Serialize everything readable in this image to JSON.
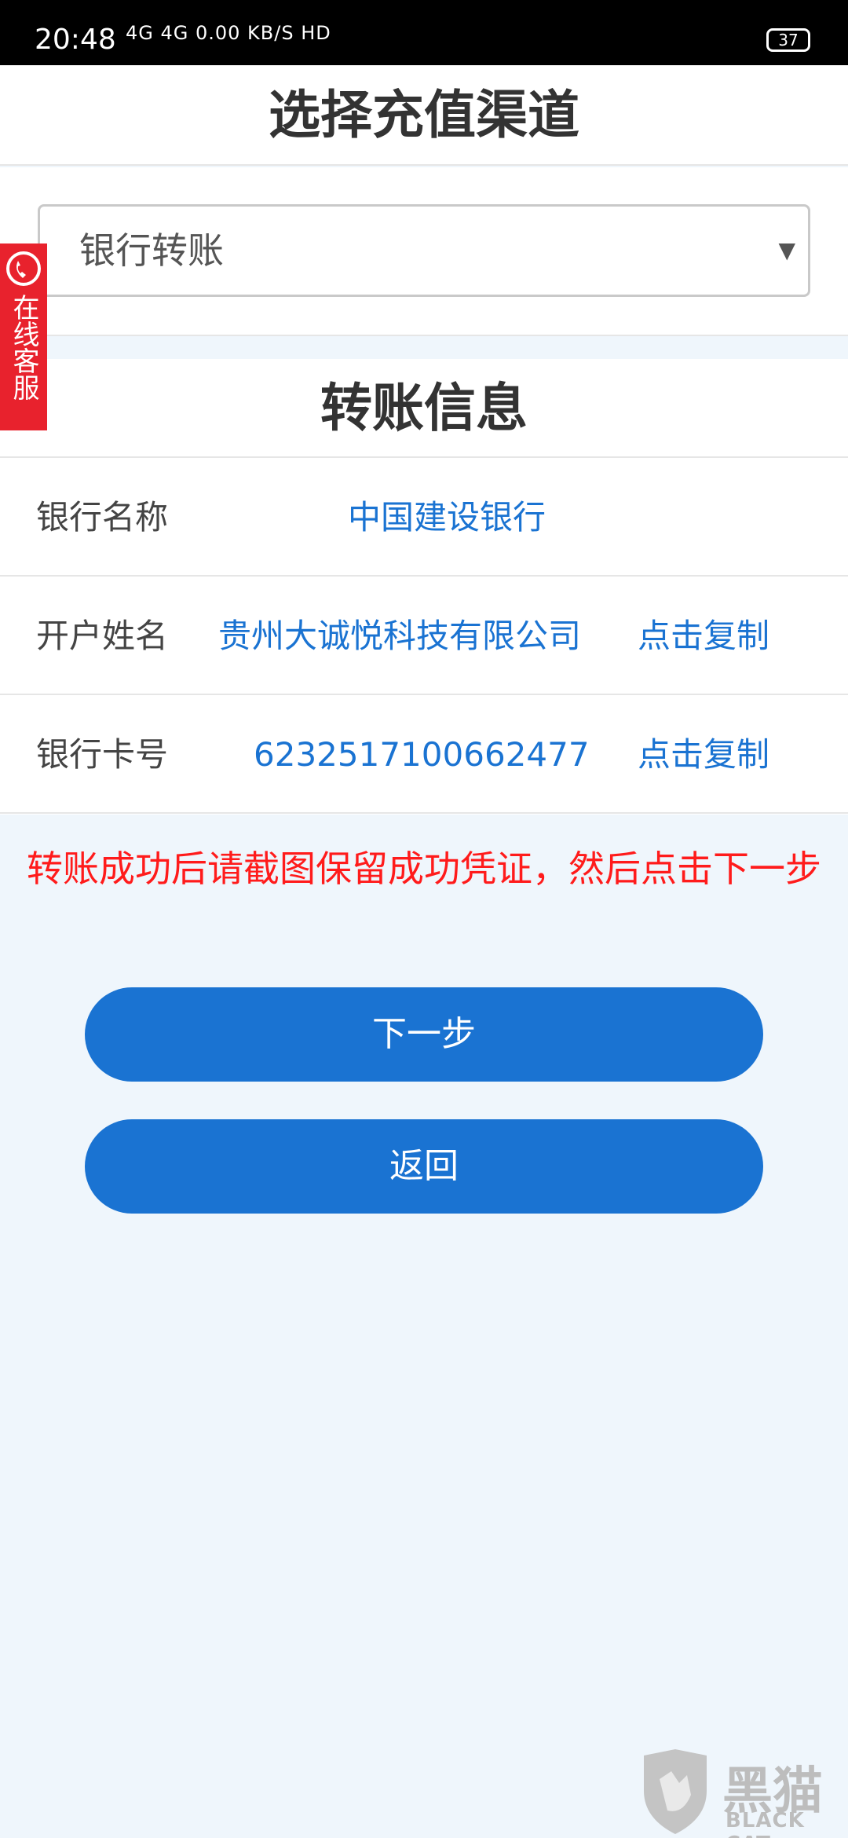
{
  "status_bar": {
    "time": "20:48",
    "signals": "4G 4G 0.00 KB/S HD",
    "battery": "37"
  },
  "header": {
    "title": "选择充值渠道"
  },
  "channel_select": {
    "value": "银行转账"
  },
  "transfer_info": {
    "title": "转账信息",
    "rows": [
      {
        "label": "银行名称",
        "value": "中国建设银行",
        "copy": ""
      },
      {
        "label": "开户姓名",
        "value": "贵州大诚悦科技有限公司",
        "copy": "点击复制"
      },
      {
        "label": "银行卡号",
        "value": "6232517100662477",
        "copy": "点击复制"
      }
    ]
  },
  "notice": "转账成功后请截图保留成功凭证，然后点击下一步",
  "buttons": {
    "next": "下一步",
    "back": "返回"
  },
  "side_service": {
    "label": "在线客服",
    "icon": "phone-icon"
  },
  "watermark": {
    "cn": "黑猫",
    "en": "BLACK CAT"
  },
  "colors": {
    "accent": "#1a73d2",
    "warning": "#ff1b1b",
    "service": "#e8222d"
  }
}
